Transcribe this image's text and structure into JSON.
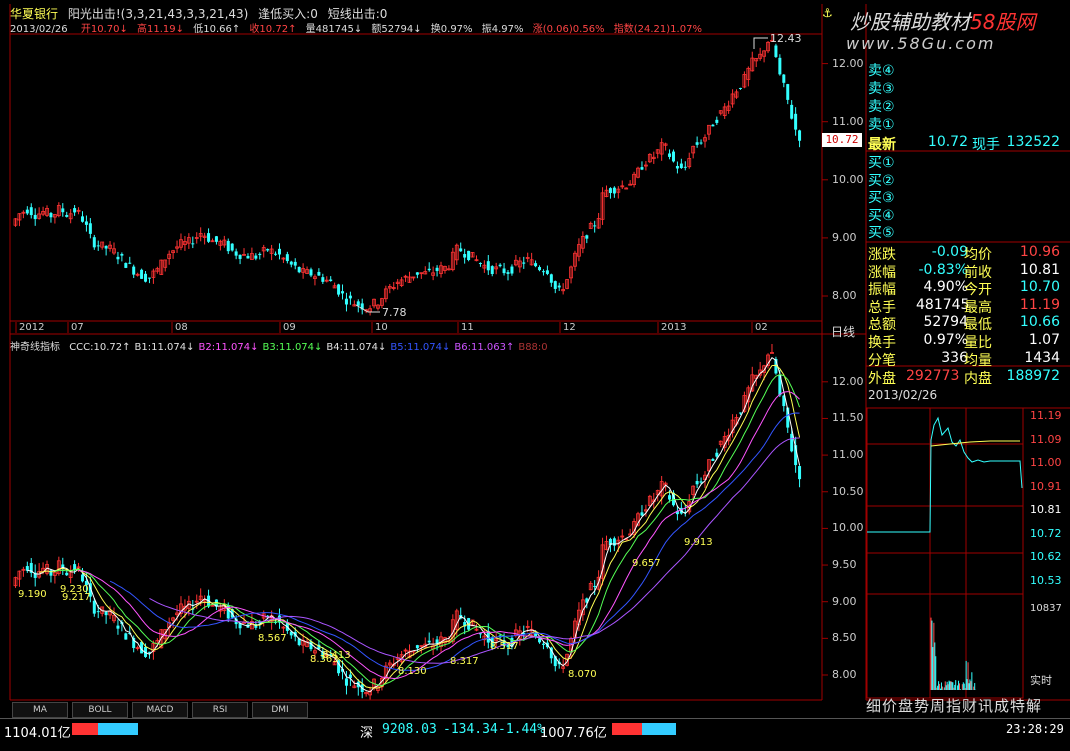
{
  "header": {
    "stock_name": "华夏银行",
    "formula": "阳光出击!(3,3,21,43,3,3,21,43)",
    "signal1": "逢低买入:0",
    "signal2": "短线出击:0",
    "date": "2013/02/26",
    "open": "开10.70↓",
    "high": "高11.19↓",
    "low": "低10.66↑",
    "close": "收10.72↑",
    "volume": "量481745↓",
    "amount": "额52794↓",
    "turnover": "换0.97%",
    "amplitude": "振4.97%",
    "change": "涨(0.06)0.56%",
    "index": "指数(24.21)1.07%"
  },
  "watermark": {
    "title": "炒股辅助教材",
    "site_brand": "58股网",
    "url": "www.58Gu.com"
  },
  "upper_chart": {
    "high_marker": "12.43",
    "low_marker": "7.78",
    "current_price": "10.72",
    "y_ticks": [
      "12.00",
      "11.00",
      "10.00",
      "9.00",
      "8.00"
    ],
    "x_ticks": [
      "2012",
      "07",
      "08",
      "09",
      "10",
      "11",
      "12",
      "2013",
      "02"
    ],
    "period_label": "日线"
  },
  "lower_chart": {
    "indicator_name": "神奇线指标",
    "values": [
      {
        "text": "CCC:10.72↑",
        "color": "#e0e0e0"
      },
      {
        "text": "B1:11.074↓",
        "color": "#e0e0e0"
      },
      {
        "text": "B2:11.074↓",
        "color": "#ff55ff"
      },
      {
        "text": "B3:11.074↓",
        "color": "#55ff55"
      },
      {
        "text": "B4:11.074↓",
        "color": "#e0e0e0"
      },
      {
        "text": "B5:11.074↓",
        "color": "#3355ff"
      },
      {
        "text": "B6:11.063↑",
        "color": "#cc55ff"
      },
      {
        "text": "B88:0",
        "color": "#aa3333"
      }
    ],
    "y_ticks": [
      "12.00",
      "11.50",
      "11.00",
      "10.50",
      "10.00",
      "9.50",
      "9.00",
      "8.50",
      "8.00"
    ],
    "annotations": [
      "9.190",
      "9.230",
      "9.217",
      "8.567",
      "8.413",
      "8.363",
      "8.130",
      "8.317",
      "8.517",
      "8.070",
      "9.657",
      "9.913"
    ]
  },
  "order_book": {
    "sell_labels": [
      "卖④",
      "卖③",
      "卖②",
      "卖①"
    ],
    "buy_labels": [
      "买①",
      "买②",
      "买③",
      "买④",
      "买⑤"
    ],
    "latest_label": "最新",
    "latest_value": "10.72",
    "now_hand_label": "现手",
    "now_hand_value": "132522"
  },
  "quote": [
    {
      "l1": "涨跌",
      "v1": "-0.09",
      "l2": "均价",
      "v2": "10.96",
      "c1": "#3ff",
      "c2": "#ff4444"
    },
    {
      "l1": "涨幅",
      "v1": "-0.83%",
      "l2": "前收",
      "v2": "10.81",
      "c1": "#3ff",
      "c2": "#ffffff"
    },
    {
      "l1": "振幅",
      "v1": "4.90%",
      "l2": "今开",
      "v2": "10.70",
      "c1": "#ffffff",
      "c2": "#3ff"
    },
    {
      "l1": "总手",
      "v1": "481745",
      "l2": "最高",
      "v2": "11.19",
      "c1": "#ffffff",
      "c2": "#ff4444"
    },
    {
      "l1": "总额",
      "v1": "52794",
      "l2": "最低",
      "v2": "10.66",
      "c1": "#ffffff",
      "c2": "#3ff"
    },
    {
      "l1": "换手",
      "v1": "0.97%",
      "l2": "量比",
      "v2": "1.07",
      "c1": "#ffffff",
      "c2": "#ffffff"
    },
    {
      "l1": "分笔",
      "v1": "336",
      "l2": "均量",
      "v2": "1434",
      "c1": "#ffffff",
      "c2": "#ffffff"
    }
  ],
  "outer_inner": {
    "outer_label": "外盘",
    "outer_value": "292773",
    "inner_label": "内盘",
    "inner_value": "188972"
  },
  "mini_chart": {
    "date": "2013/02/26",
    "y_ticks": [
      "11.19",
      "11.09",
      "11.00",
      "10.91",
      "10.81",
      "10.72",
      "10.62",
      "10.53"
    ],
    "volume_tick": "10837",
    "realtime_label": "实时"
  },
  "bottom_tabs": [
    "MA",
    "BOLL",
    "MACD",
    "RSI",
    "DMI"
  ],
  "right_bottom_tabs": "细价盘势周指财讯成特解",
  "status_bar": {
    "left_amount": "1104.01亿",
    "market": "深",
    "index_value": "9208.03",
    "index_change": "-134.34",
    "index_pct": "-1.44%",
    "turnover": "1007.76亿",
    "time": "23:28:29"
  },
  "colors": {
    "up": "#ff3333",
    "down": "#33ffff",
    "grid": "#8b0000",
    "label": "#ffff55"
  }
}
